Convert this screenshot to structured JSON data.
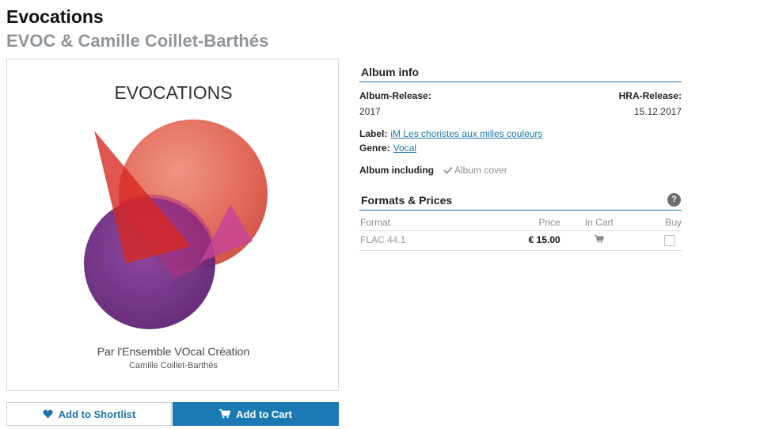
{
  "album": {
    "title": "Evocations",
    "artist": "EVOC & Camille Coillet-Barthés"
  },
  "cover": {
    "heading": "EVOCATIONS",
    "line1": "Par l'Ensemble VOcal Création",
    "line2": "Camille Coillet-Barthés"
  },
  "actions": {
    "shortlist_label": "Add to Shortlist",
    "cart_label": "Add to Cart"
  },
  "album_info": {
    "heading": "Album info",
    "release_label": "Album-Release:",
    "release_value": "2017",
    "hra_label": "HRA-Release:",
    "hra_value": "15.12.2017",
    "label_label": "Label:",
    "label_value": "iM Les choristes aux milles couleurs",
    "genre_label": "Genre:",
    "genre_value": "Vocal",
    "including_label": "Album including",
    "including_value": "Album cover"
  },
  "formats": {
    "heading": "Formats & Prices",
    "help": "?",
    "columns": {
      "format": "Format",
      "price": "Price",
      "in_cart": "In Cart",
      "buy": "Buy"
    },
    "rows": [
      {
        "format": "FLAC 44.1",
        "price": "€ 15.00"
      }
    ]
  },
  "colors": {
    "accent": "#1b7ab3",
    "link": "#1a75a8",
    "muted_title": "#8f959a"
  }
}
